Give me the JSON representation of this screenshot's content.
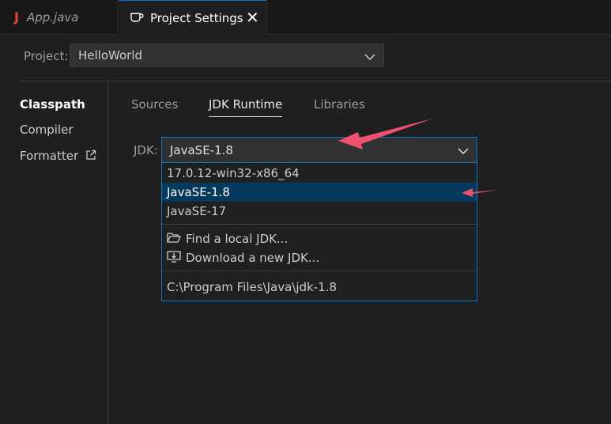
{
  "tabs": [
    {
      "icon": "J",
      "label": "App.java"
    },
    {
      "label": "Project Settings",
      "close": "✕"
    }
  ],
  "project": {
    "label": "Project:",
    "value": "HelloWorld"
  },
  "sidebar": {
    "items": [
      {
        "label": "Classpath"
      },
      {
        "label": "Compiler"
      },
      {
        "label": "Formatter"
      }
    ]
  },
  "subtabs": [
    {
      "label": "Sources"
    },
    {
      "label": "JDK Runtime"
    },
    {
      "label": "Libraries"
    }
  ],
  "jdk": {
    "label": "JDK:",
    "value": "JavaSE-1.8",
    "options": [
      "17.0.12-win32-x86_64",
      "JavaSE-1.8",
      "JavaSE-17"
    ],
    "actions": [
      "Find a local JDK...",
      "Download a new JDK..."
    ],
    "path": "C:\\Program Files\\Java\\jdk-1.8"
  },
  "colors": {
    "accent": "#0078d4",
    "selected": "#04395e",
    "annotation": "#f0506e"
  }
}
